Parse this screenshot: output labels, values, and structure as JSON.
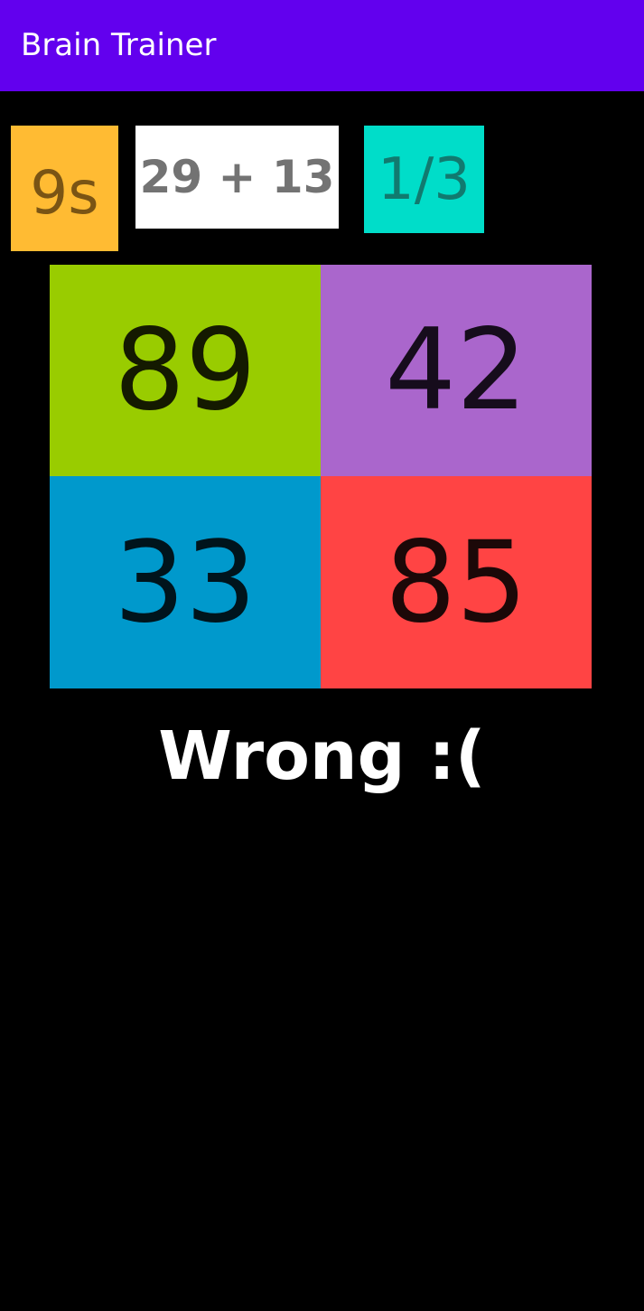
{
  "app_bar": {
    "title": "Brain Trainer",
    "color": "#6200ee"
  },
  "game": {
    "timer": "9s",
    "question": "29 + 13",
    "score": "1/3",
    "answers": [
      "89",
      "42",
      "33",
      "85"
    ],
    "answer_colors": [
      "#99cc00",
      "#aa66cc",
      "#0099cc",
      "#ff4444"
    ],
    "result": "Wrong :("
  }
}
